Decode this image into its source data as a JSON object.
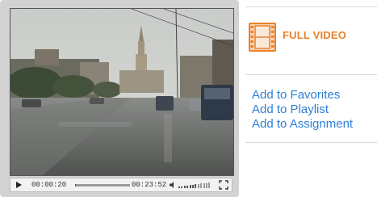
{
  "player": {
    "current_time": "00:00:20",
    "total_time": "00:23:52",
    "progress_fraction": 0.014,
    "volume_fraction": 0.65
  },
  "sidebar": {
    "full_video_label": "FULL VIDEO",
    "actions": [
      {
        "label": "Add to Favorites"
      },
      {
        "label": "Add to Playlist"
      },
      {
        "label": "Add to Assignment"
      }
    ]
  },
  "colors": {
    "accent_orange": "#e8822a",
    "link_blue": "#2f7fd6"
  },
  "icons": {
    "play": "play-icon",
    "volume": "volume-icon",
    "fullscreen": "fullscreen-icon",
    "film": "film-icon"
  }
}
